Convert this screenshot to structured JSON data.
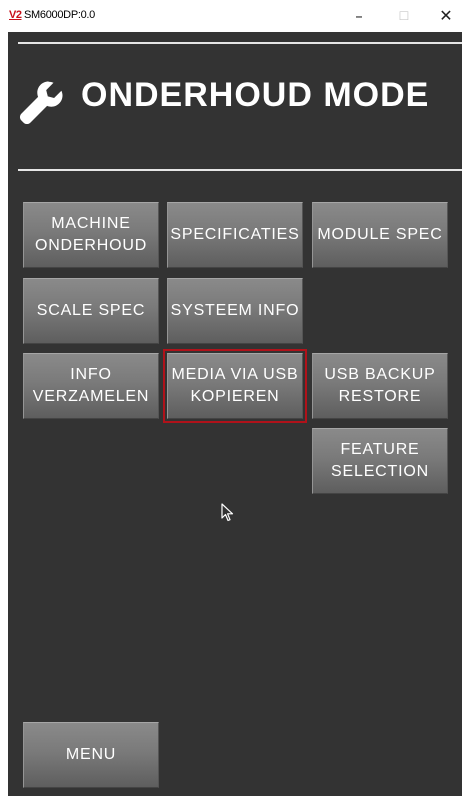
{
  "window": {
    "icon_text": "V2",
    "title": "SM6000DP:0.0",
    "minimize_glyph": "–",
    "maximize_glyph": "☐",
    "close_glyph": "✕"
  },
  "header": {
    "icon": "wrench-icon",
    "title": "ONDERHOUD MODE"
  },
  "buttons": {
    "machine_onderhoud": "MACHINE\nONDERHOUD",
    "specificaties": "SPECIFICATIES",
    "module_spec": "MODULE SPEC",
    "scale_spec": "SCALE SPEC",
    "systeem_info": "SYSTEEM INFO",
    "info_verzamelen": "INFO\nVERZAMELEN",
    "media_via_usb": "MEDIA VIA USB\nKOPIEREN",
    "usb_backup": "USB BACKUP\nRESTORE",
    "feature_selection": "FEATURE\nSELECTION",
    "menu": "MENU"
  },
  "selected_button": "media_via_usb",
  "colors": {
    "background": "#333333",
    "button": "#7a7a7a",
    "selection_outline": "#b0121a",
    "text": "#ffffff"
  }
}
